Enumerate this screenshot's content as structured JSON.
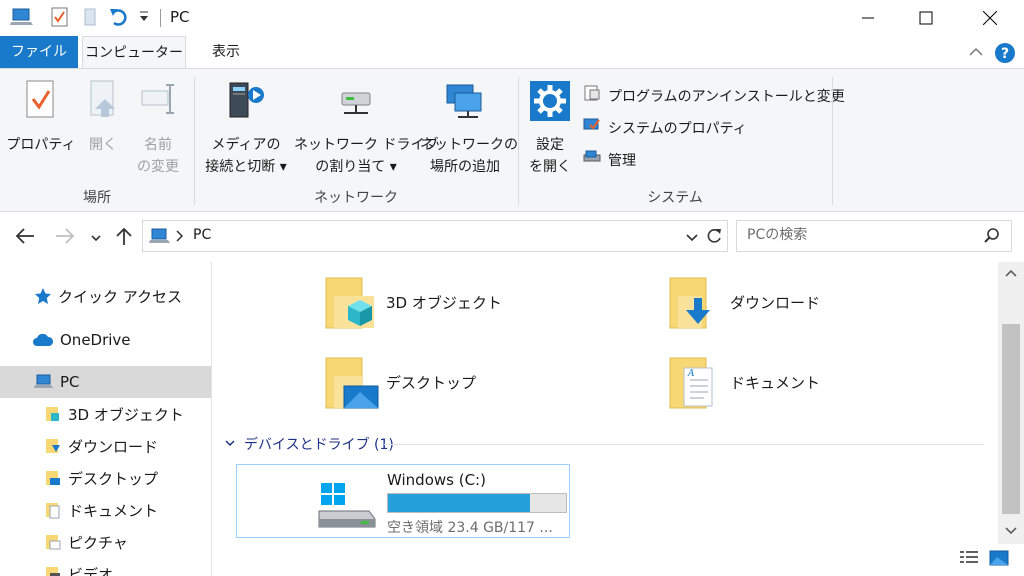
{
  "window": {
    "title": "PC"
  },
  "tabs": {
    "file": "ファイル",
    "computer": "コンピューター",
    "view": "表示"
  },
  "ribbon": {
    "location": {
      "label": "場所",
      "properties": "プロパティ",
      "open": "開く",
      "rename_line1": "名前",
      "rename_line2": "の変更"
    },
    "network": {
      "label": "ネットワーク",
      "media_line1": "メディアの",
      "media_line2": "接続と切断",
      "map_drive_line1": "ネットワーク ドライブ",
      "map_drive_line2": "の割り当て",
      "add_location_line1": "ネットワークの",
      "add_location_line2": "場所の追加"
    },
    "system": {
      "label": "システム",
      "settings_line1": "設定",
      "settings_line2": "を開く",
      "uninstall": "プログラムのアンインストールと変更",
      "system_properties": "システムのプロパティ",
      "manage": "管理"
    }
  },
  "address": {
    "path": "PC",
    "search_placeholder": "PCの検索"
  },
  "nav": {
    "items": [
      {
        "label": "クイック アクセス"
      },
      {
        "label": "OneDrive"
      },
      {
        "label": "PC"
      },
      {
        "label": "3D オブジェクト"
      },
      {
        "label": "ダウンロード"
      },
      {
        "label": "デスクトップ"
      },
      {
        "label": "ドキュメント"
      },
      {
        "label": "ピクチャ"
      },
      {
        "label": "ビデオ"
      }
    ]
  },
  "folders": [
    {
      "name": "3D オブジェクト"
    },
    {
      "name": "ダウンロード"
    },
    {
      "name": "デスクトップ"
    },
    {
      "name": "ドキュメント"
    }
  ],
  "devices": {
    "header": "デバイスとドライブ (1)",
    "drive": {
      "name": "Windows (C:)",
      "free_text": "空き領域 23.4 GB/117 ...",
      "used_fraction": 0.8
    }
  },
  "colors": {
    "accent": "#1979ca",
    "drive_bar": "#26a0da",
    "folder_yellow": "#f8d775"
  }
}
